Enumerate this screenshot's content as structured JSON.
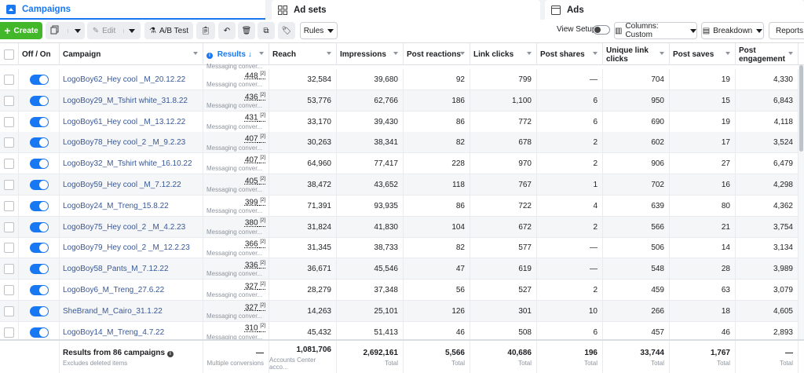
{
  "tabs": {
    "campaigns": "Campaigns",
    "adsets": "Ad sets",
    "ads": "Ads"
  },
  "toolbar": {
    "create": "Create",
    "edit": "Edit",
    "abtest": "A/B Test",
    "rules": "Rules",
    "view_setup": "View Setup",
    "columns": "Columns: Custom",
    "breakdown": "Breakdown",
    "reports": "Reports"
  },
  "headers": {
    "onoff": "Off / On",
    "campaign": "Campaign",
    "results": "Results",
    "reach": "Reach",
    "impressions": "Impressions",
    "post_reactions": "Post reactions",
    "link_clicks": "Link clicks",
    "post_shares": "Post shares",
    "unique_link_clicks": "Unique link clicks",
    "post_saves": "Post saves",
    "post_engagement": "Post engagement"
  },
  "top_stub_label": "Messaging conver...",
  "rows": [
    {
      "name": "LogoBoy62_Hey cool _M_20.12.22",
      "results": "448",
      "sup": "[2]",
      "res_label": "Messaging conver...",
      "reach": "32,584",
      "impressions": "39,680",
      "reactions": "92",
      "link_clicks": "799",
      "shares": "—",
      "unique": "704",
      "saves": "19",
      "engagement": "4,330"
    },
    {
      "name": "LogoBoy29_M_Tshirt white_31.8.22",
      "results": "436",
      "sup": "[2]",
      "res_label": "Messaging conver...",
      "reach": "53,776",
      "impressions": "62,766",
      "reactions": "186",
      "link_clicks": "1,100",
      "shares": "6",
      "unique": "950",
      "saves": "15",
      "engagement": "6,843"
    },
    {
      "name": "LogoBoy61_Hey cool _M_13.12.22",
      "results": "431",
      "sup": "[2]",
      "res_label": "Messaging conver...",
      "reach": "33,170",
      "impressions": "39,430",
      "reactions": "86",
      "link_clicks": "772",
      "shares": "6",
      "unique": "690",
      "saves": "19",
      "engagement": "4,118"
    },
    {
      "name": "LogoBoy78_Hey cool_2 _M_9.2.23",
      "results": "407",
      "sup": "[2]",
      "res_label": "Messaging conver...",
      "reach": "30,263",
      "impressions": "38,341",
      "reactions": "82",
      "link_clicks": "678",
      "shares": "2",
      "unique": "602",
      "saves": "17",
      "engagement": "3,524"
    },
    {
      "name": "LogoBoy32_M_Tshirt white_16.10.22",
      "results": "407",
      "sup": "[2]",
      "res_label": "Messaging conver...",
      "reach": "64,960",
      "impressions": "77,417",
      "reactions": "228",
      "link_clicks": "970",
      "shares": "2",
      "unique": "906",
      "saves": "27",
      "engagement": "6,479"
    },
    {
      "name": "LogoBoy59_Hey cool _M_7.12.22",
      "results": "405",
      "sup": "[2]",
      "res_label": "Messaging conver...",
      "reach": "38,472",
      "impressions": "43,652",
      "reactions": "118",
      "link_clicks": "767",
      "shares": "1",
      "unique": "702",
      "saves": "16",
      "engagement": "4,298"
    },
    {
      "name": "LogoBoy24_M_Treng_15.8.22",
      "results": "399",
      "sup": "[2]",
      "res_label": "Messaging conver...",
      "reach": "71,391",
      "impressions": "93,935",
      "reactions": "86",
      "link_clicks": "722",
      "shares": "4",
      "unique": "639",
      "saves": "80",
      "engagement": "4,362"
    },
    {
      "name": "LogoBoy75_Hey cool_2 _M_4.2.23",
      "results": "380",
      "sup": "[2]",
      "res_label": "Messaging conver...",
      "reach": "31,824",
      "impressions": "41,830",
      "reactions": "104",
      "link_clicks": "672",
      "shares": "2",
      "unique": "566",
      "saves": "21",
      "engagement": "3,754"
    },
    {
      "name": "LogoBoy79_Hey cool_2 _M_12.2.23",
      "results": "366",
      "sup": "[2]",
      "res_label": "Messaging conver...",
      "reach": "31,345",
      "impressions": "38,733",
      "reactions": "82",
      "link_clicks": "577",
      "shares": "—",
      "unique": "506",
      "saves": "14",
      "engagement": "3,134"
    },
    {
      "name": "LogoBoy58_Pants_M_7.12.22",
      "results": "336",
      "sup": "[2]",
      "res_label": "Messaging conver...",
      "reach": "36,671",
      "impressions": "45,546",
      "reactions": "47",
      "link_clicks": "619",
      "shares": "—",
      "unique": "548",
      "saves": "28",
      "engagement": "3,989"
    },
    {
      "name": "LogoBoy6_M_Treng_27.6.22",
      "results": "327",
      "sup": "[2]",
      "res_label": "Messaging conver...",
      "reach": "28,279",
      "impressions": "37,348",
      "reactions": "56",
      "link_clicks": "527",
      "shares": "2",
      "unique": "459",
      "saves": "63",
      "engagement": "3,079"
    },
    {
      "name": "SheBrand_M_Cairo_31.1.22",
      "results": "327",
      "sup": "[2]",
      "res_label": "Messaging conver...",
      "reach": "14,263",
      "impressions": "25,101",
      "reactions": "126",
      "link_clicks": "301",
      "shares": "10",
      "unique": "266",
      "saves": "18",
      "engagement": "4,605"
    },
    {
      "name": "LogoBoy14_M_Treng_4.7.22",
      "results": "310",
      "sup": "[2]",
      "res_label": "Messaging conver...",
      "reach": "45,432",
      "impressions": "51,413",
      "reactions": "46",
      "link_clicks": "508",
      "shares": "6",
      "unique": "457",
      "saves": "46",
      "engagement": "2,893"
    }
  ],
  "footer": {
    "title": "Results from 86 campaigns",
    "subtitle": "Excludes deleted items",
    "results": "—",
    "results_sub": "Multiple conversions",
    "reach": "1,081,706",
    "reach_sub": "Accounts Center acco...",
    "impressions": "2,692,161",
    "impressions_sub": "Total",
    "reactions": "5,566",
    "reactions_sub": "Total",
    "link_clicks": "40,686",
    "link_clicks_sub": "Total",
    "shares": "196",
    "shares_sub": "Total",
    "unique": "33,744",
    "unique_sub": "Total",
    "saves": "1,767",
    "saves_sub": "Total",
    "engagement": "—",
    "engagement_sub": "Total"
  },
  "colors": {
    "accent": "#1877f2",
    "create_green": "#42b72a",
    "link": "#385898"
  }
}
